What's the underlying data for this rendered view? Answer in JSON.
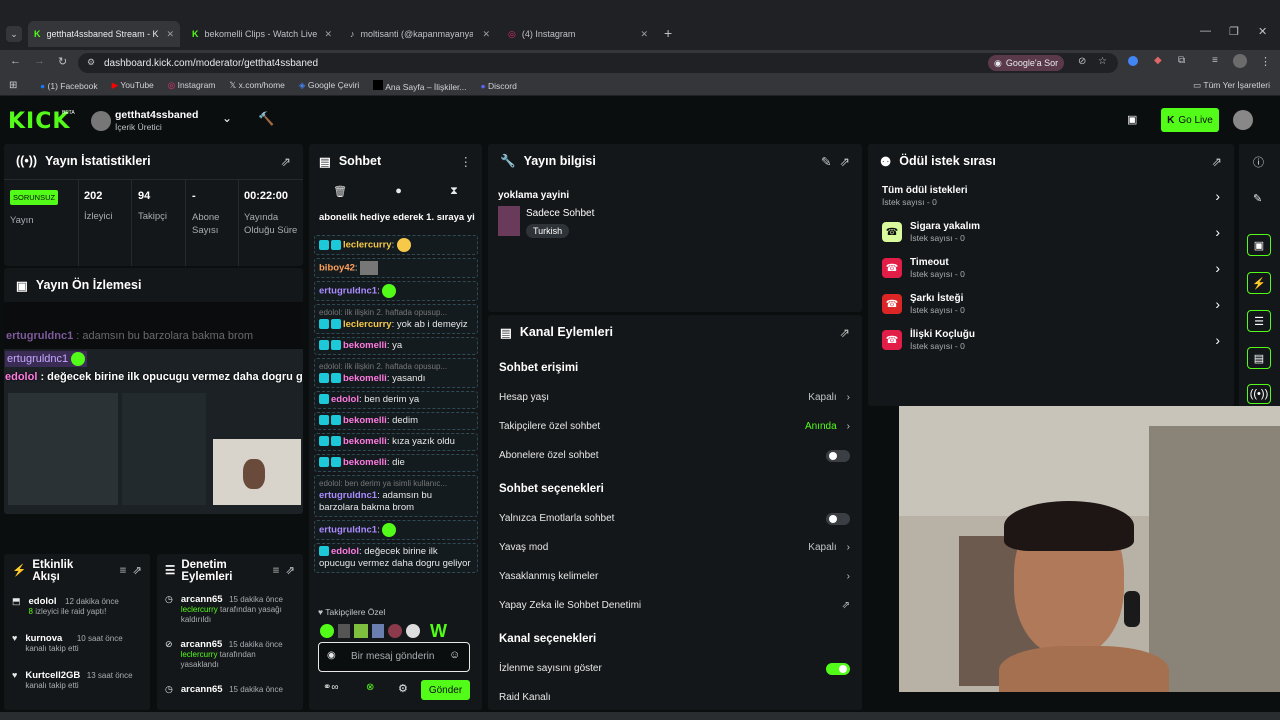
{
  "browser": {
    "tabs": [
      {
        "title": "getthat4ssbaned Stream - Kick",
        "active": true,
        "color": "#53fc18"
      },
      {
        "title": "bekomelli Clips - Watch Live on",
        "active": false,
        "color": "#53fc18"
      },
      {
        "title": "moltisanti (@kapanmayanyaray",
        "active": false,
        "color": "#ffffff"
      },
      {
        "title": "(4) Instagram",
        "active": false,
        "color": "#e1306c"
      }
    ],
    "url": "dashboard.kick.com/moderator/getthat4ssbaned",
    "google_btn": "Google'a Sor",
    "bookmarks": [
      "(1) Facebook",
      "YouTube",
      "Instagram",
      "x.com/home",
      "Google Çeviri",
      "Ana Sayfa – İlişkiler...",
      "Discord"
    ],
    "all_bookmarks": "Tüm Yer İşaretleri"
  },
  "header": {
    "logo": "KICK",
    "beta": "BETA",
    "channel": "getthat4ssbaned",
    "role": "İçerik Üretici",
    "go_live": "Go Live"
  },
  "stats": {
    "title": "Yayın İstatistikleri",
    "status": "SORUNSUZ",
    "status_label": "Yayın",
    "viewers": "202",
    "viewers_label": "İzleyici",
    "followers": "94",
    "followers_label": "Takipçi",
    "subs": "-",
    "subs_label": "Abone Sayısı",
    "uptime": "00:22:00",
    "uptime_label": "Yayında Olduğu Süre"
  },
  "preview": {
    "title": "Yayın Ön İzlemesi",
    "line1_user": "ertugruldnc1",
    "line1_text": " : adamsın bu barzolara bakma brom",
    "line2_user": "ertugruldnc1",
    "line3_user": "edolol",
    "line3_text": " : değecek birine ilk opucugu vermez daha dogru geliyor"
  },
  "activity": {
    "title": "Etkinlik Akışı",
    "items": [
      {
        "user": "edolol",
        "time": "12 dakika önce",
        "desc_hl": "8",
        "desc": " izleyici ile raid yaptı!"
      },
      {
        "user": "kurnova",
        "time": "10 saat önce",
        "desc": "kanalı takip etti"
      },
      {
        "user": "Kurtcell2GB",
        "time": "13 saat önce",
        "desc": "kanalı takip etti"
      }
    ]
  },
  "mod": {
    "title": "Denetim Eylemleri",
    "items": [
      {
        "user": "arcann65",
        "time": "15 dakika önce",
        "target": "leclercurry",
        "desc": " tarafından yasağı kaldırıldı"
      },
      {
        "user": "arcann65",
        "time": "15 dakika önce",
        "target": "leclercurry",
        "desc": " tarafından yasaklandı"
      },
      {
        "user": "arcann65",
        "time": "15 dakika önce"
      }
    ]
  },
  "chat": {
    "title": "Sohbet",
    "pinned": "abonelik hediye ederek 1. sıraya yi",
    "messages": [
      {
        "user": "leclercurry",
        "color": "#f7c948",
        "text": ":"
      },
      {
        "user": "biboy42",
        "color": "#ff9f5a",
        "text": ":"
      },
      {
        "user": "ertugruldnc1",
        "color": "#a98bff",
        "text": ":"
      },
      {
        "reply": "edolol: ilk ilişkin 2. haftada opusup...",
        "user": "leclercurry",
        "color": "#f7c948",
        "text": ": yok ab i demeyiz"
      },
      {
        "user": "bekomelli",
        "color": "#ff7ae1",
        "text": ": ya"
      },
      {
        "reply": "edolol: ilk ilişkin 2. haftada opusup...",
        "user": "bekomelli",
        "color": "#ff7ae1",
        "text": ": yasandı"
      },
      {
        "user": "edolol",
        "color": "#ff7ae1",
        "text": ": ben derim ya"
      },
      {
        "user": "bekomelli",
        "color": "#ff7ae1",
        "text": ": dedim"
      },
      {
        "user": "bekomelli",
        "color": "#ff7ae1",
        "text": ": kıza yazık oldu"
      },
      {
        "user": "bekomelli",
        "color": "#ff7ae1",
        "text": ": die"
      },
      {
        "reply": "edolol: ben derim ya isimli kullanıc...",
        "user": "ertugruldnc1",
        "color": "#a98bff",
        "text": ": adamsın bu barzolara bakma brom"
      },
      {
        "user": "ertugruldnc1",
        "color": "#a98bff",
        "text": ":"
      },
      {
        "user": "edolol",
        "color": "#ff7ae1",
        "text": ": değecek birine ilk opucugu vermez daha dogru geliyor"
      }
    ],
    "followers_only": "Takipçilere Özel",
    "placeholder": "Bir mesaj gönderin",
    "send": "Gönder"
  },
  "stream_info": {
    "title": "Yayın bilgisi",
    "stream_title": "yoklama yayini",
    "category": "Sadece Sohbet",
    "tag": "Turkish"
  },
  "channel_actions": {
    "title": "Kanal Eylemleri",
    "chat_access": "Sohbet erişimi",
    "account_age": "Hesap yaşı",
    "account_age_val": "Kapalı",
    "followers_chat": "Takipçilere özel sohbet",
    "followers_chat_val": "Anında",
    "subs_chat": "Abonelere özel sohbet",
    "chat_options": "Sohbet seçenekleri",
    "emote_only": "Yalnızca Emotlarla sohbet",
    "slow_mode": "Yavaş mod",
    "slow_mode_val": "Kapalı",
    "banned_words": "Yasaklanmış kelimeler",
    "ai_mod": "Yapay Zeka ile Sohbet Denetimi",
    "channel_options": "Kanal seçenekleri",
    "show_viewers": "İzlenme sayısını göster",
    "raid": "Raid Kanalı"
  },
  "rewards": {
    "title": "Ödül istek sırası",
    "all": {
      "name": "Tüm ödül istekleri",
      "count": "İstek sayısı - 0"
    },
    "items": [
      {
        "name": "Sigara yakalım",
        "count": "İstek sayısı - 0",
        "color": "#d9f99d"
      },
      {
        "name": "Timeout",
        "count": "İstek sayısı - 0",
        "color": "#e11d48"
      },
      {
        "name": "Şarkı İsteği",
        "count": "İstek sayısı - 0",
        "color": "#dc2626"
      },
      {
        "name": "İlişki Koçluğu",
        "count": "İstek sayısı - 0",
        "color": "#e11d48"
      }
    ]
  }
}
